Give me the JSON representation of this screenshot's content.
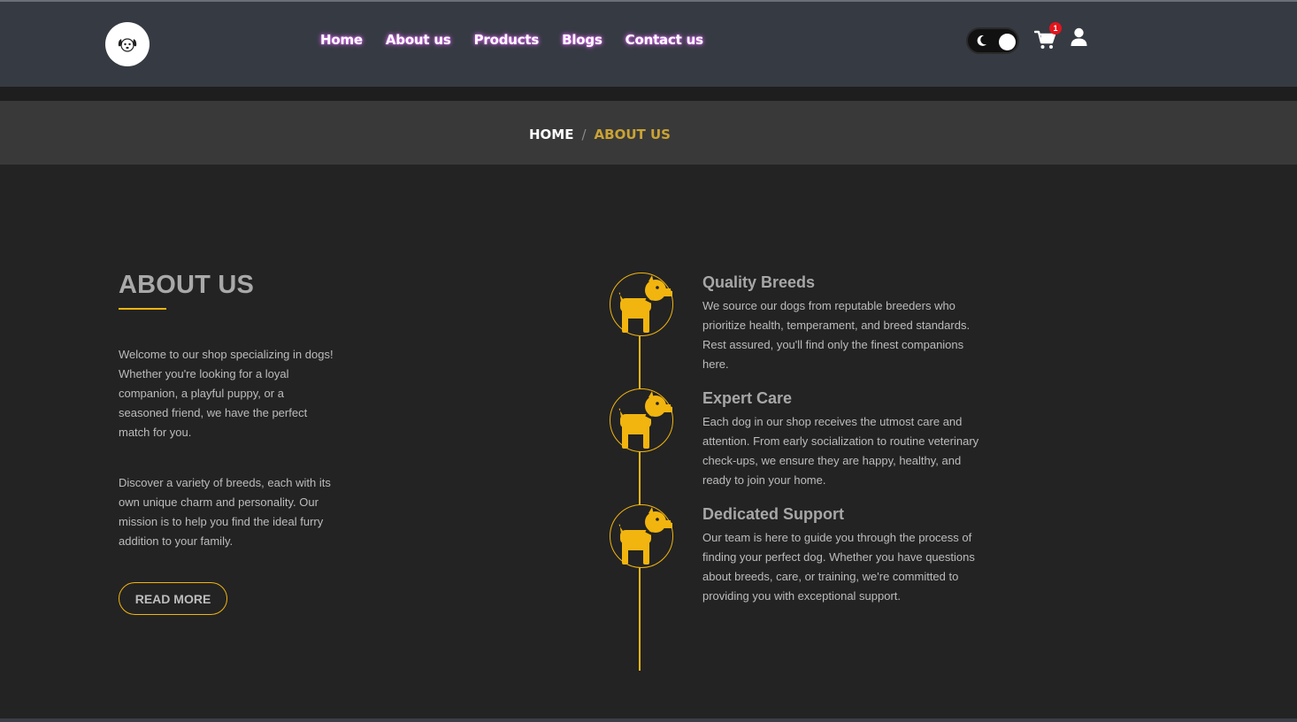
{
  "nav": {
    "logo_icon": "dog-face-logo-icon",
    "links": [
      "Home",
      "About us",
      "Products",
      "Blogs",
      "Contact us"
    ],
    "theme_toggle_icon": "moon-icon",
    "cart_icon": "shopping-cart-icon",
    "cart_count": "1",
    "user_icon": "user-icon"
  },
  "breadcrumb": {
    "home": "HOME",
    "separator": "/",
    "current": "ABOUT US"
  },
  "about": {
    "title": "ABOUT US",
    "paragraph1": "Welcome to our shop specializing in dogs! Whether you're looking for a loyal companion, a playful puppy, or a seasoned friend, we have the perfect match for you.",
    "paragraph2": "Discover a variety of breeds, each with its own unique charm and personality. Our mission is to help you find the ideal furry addition to your family.",
    "read_more": "READ MORE"
  },
  "features": [
    {
      "icon": "dog-icon",
      "title": "Quality Breeds",
      "text": "We source our dogs from reputable breeders who prioritize health, temperament, and breed standards. Rest assured, you'll find only the finest companions here."
    },
    {
      "icon": "dog-icon",
      "title": "Expert Care",
      "text": "Each dog in our shop receives the utmost care and attention. From early socialization to routine veterinary check-ups, we ensure they are happy, healthy, and ready to join your home."
    },
    {
      "icon": "dog-icon",
      "title": "Dedicated Support",
      "text": "Our team is here to guide you through the process of finding your perfect dog. Whether you have questions about breeds, care, or training, we're committed to providing you with exceptional support."
    }
  ],
  "colors": {
    "accent": "#f2b50f",
    "navbar_bg": "#363a43",
    "page_bg": "#232323",
    "breadcrumb_bg": "#393939",
    "badge": "#e3141c"
  }
}
